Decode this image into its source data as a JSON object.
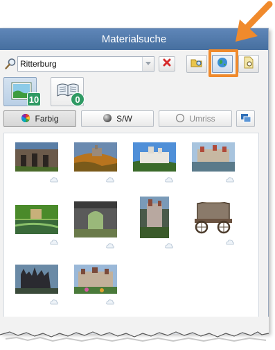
{
  "window": {
    "title": "Materialsuche"
  },
  "search": {
    "value": "Ritterburg",
    "placeholder": ""
  },
  "tabs": [
    {
      "name": "images",
      "count": "10",
      "active": true
    },
    {
      "name": "text-documents",
      "count": "0",
      "active": false
    }
  ],
  "color_modes": [
    {
      "label": "Farbig",
      "active": true,
      "icon": "color-wheel-icon"
    },
    {
      "label": "S/W",
      "active": false,
      "icon": "grayscale-sphere-icon"
    },
    {
      "label": "Umriss",
      "active": false,
      "icon": "outline-circle-icon"
    }
  ],
  "toolbar": {
    "buttons": [
      {
        "icon": "folder-search-icon"
      },
      {
        "icon": "globe-icon",
        "highlighted": true
      },
      {
        "icon": "document-search-icon"
      }
    ]
  },
  "results": [
    {
      "subject": "castle ruin arches"
    },
    {
      "subject": "castle on hill in autumn"
    },
    {
      "subject": "white fortress on rock"
    },
    {
      "subject": "castle by the lake"
    },
    {
      "subject": "castle reflected in pond"
    },
    {
      "subject": "stone archway"
    },
    {
      "subject": "castle in forest"
    },
    {
      "subject": "medieval wooden cart"
    },
    {
      "subject": "dark gothic castle"
    },
    {
      "subject": "castle with flowers"
    }
  ],
  "colors": {
    "titlebar": "#4f78aa",
    "highlight": "#f08a2c",
    "badge": "#2f9a64"
  }
}
